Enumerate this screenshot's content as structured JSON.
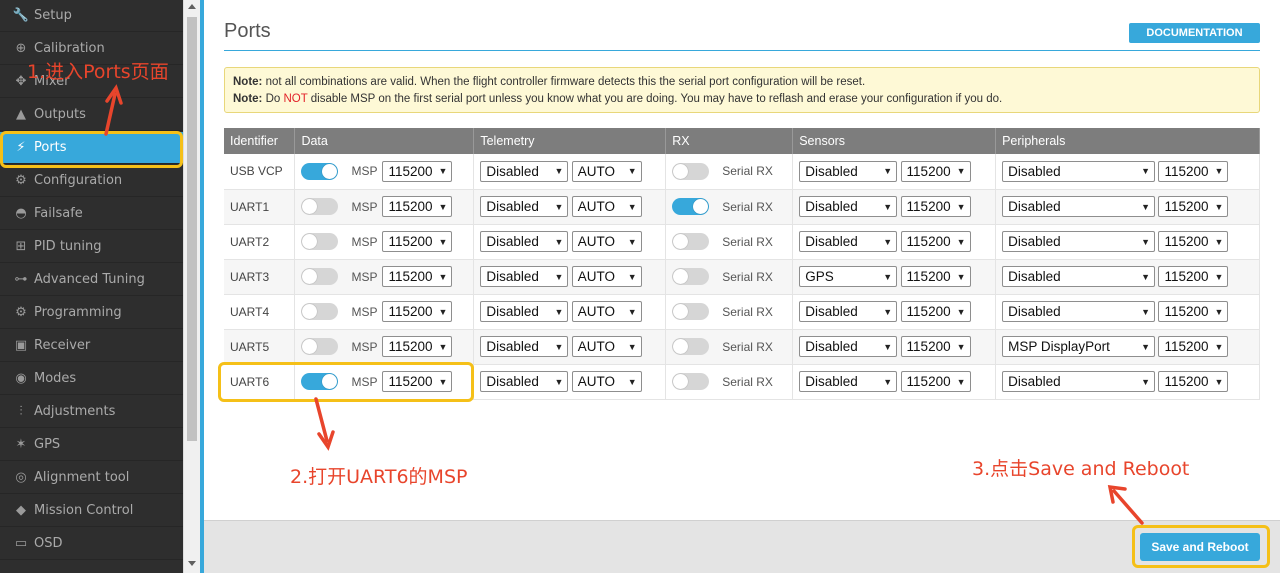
{
  "sidebar": {
    "items": [
      {
        "label": "Setup",
        "icon": "wrench-icon"
      },
      {
        "label": "Calibration",
        "icon": "crosshair-icon"
      },
      {
        "label": "Mixer",
        "icon": "mixer-icon"
      },
      {
        "label": "Outputs",
        "icon": "bolt-icon"
      },
      {
        "label": "Ports",
        "icon": "plug-icon"
      },
      {
        "label": "Configuration",
        "icon": "gear-icon"
      },
      {
        "label": "Failsafe",
        "icon": "parachute-icon"
      },
      {
        "label": "PID tuning",
        "icon": "pid-icon"
      },
      {
        "label": "Advanced Tuning",
        "icon": "tuning-icon"
      },
      {
        "label": "Programming",
        "icon": "gear-icon"
      },
      {
        "label": "Receiver",
        "icon": "receiver-icon"
      },
      {
        "label": "Modes",
        "icon": "modes-icon"
      },
      {
        "label": "Adjustments",
        "icon": "sliders-icon"
      },
      {
        "label": "GPS",
        "icon": "satellite-icon"
      },
      {
        "label": "Alignment tool",
        "icon": "compass-icon"
      },
      {
        "label": "Mission Control",
        "icon": "map-pin-icon"
      },
      {
        "label": "OSD",
        "icon": "osd-icon"
      }
    ],
    "active": "Ports"
  },
  "header": {
    "title": "Ports",
    "doc_button": "DOCUMENTATION"
  },
  "note": {
    "line1_label": "Note:",
    "line1_text": "not all combinations are valid. When the flight controller firmware detects this the serial port configuration will be reset.",
    "line2_label": "Note:",
    "line2_pre": "Do",
    "line2_not": "NOT",
    "line2_post": "disable MSP on the first serial port unless you know what you are doing. You may have to reflash and erase your configuration if you do."
  },
  "table": {
    "headers": [
      "Identifier",
      "Data",
      "Telemetry",
      "RX",
      "Sensors",
      "Peripherals"
    ],
    "msp_label": "MSP",
    "rx_label": "Serial RX",
    "rows": [
      {
        "id": "USB VCP",
        "msp_on": true,
        "msp_baud": "115200",
        "telemetry": "Disabled",
        "telemetry_baud": "AUTO",
        "rx_on": false,
        "sensors": "Disabled",
        "sensors_baud": "115200",
        "peripherals": "Disabled",
        "peripherals_baud": "115200"
      },
      {
        "id": "UART1",
        "msp_on": false,
        "msp_baud": "115200",
        "telemetry": "Disabled",
        "telemetry_baud": "AUTO",
        "rx_on": true,
        "sensors": "Disabled",
        "sensors_baud": "115200",
        "peripherals": "Disabled",
        "peripherals_baud": "115200"
      },
      {
        "id": "UART2",
        "msp_on": false,
        "msp_baud": "115200",
        "telemetry": "Disabled",
        "telemetry_baud": "AUTO",
        "rx_on": false,
        "sensors": "Disabled",
        "sensors_baud": "115200",
        "peripherals": "Disabled",
        "peripherals_baud": "115200"
      },
      {
        "id": "UART3",
        "msp_on": false,
        "msp_baud": "115200",
        "telemetry": "Disabled",
        "telemetry_baud": "AUTO",
        "rx_on": false,
        "sensors": "GPS",
        "sensors_baud": "115200",
        "peripherals": "Disabled",
        "peripherals_baud": "115200"
      },
      {
        "id": "UART4",
        "msp_on": false,
        "msp_baud": "115200",
        "telemetry": "Disabled",
        "telemetry_baud": "AUTO",
        "rx_on": false,
        "sensors": "Disabled",
        "sensors_baud": "115200",
        "peripherals": "Disabled",
        "peripherals_baud": "115200"
      },
      {
        "id": "UART5",
        "msp_on": false,
        "msp_baud": "115200",
        "telemetry": "Disabled",
        "telemetry_baud": "AUTO",
        "rx_on": false,
        "sensors": "Disabled",
        "sensors_baud": "115200",
        "peripherals": "MSP DisplayPort",
        "peripherals_baud": "115200"
      },
      {
        "id": "UART6",
        "msp_on": true,
        "msp_baud": "115200",
        "telemetry": "Disabled",
        "telemetry_baud": "AUTO",
        "rx_on": false,
        "sensors": "Disabled",
        "sensors_baud": "115200",
        "peripherals": "Disabled",
        "peripherals_baud": "115200"
      }
    ]
  },
  "footer": {
    "save_button": "Save and Reboot"
  },
  "annotations": {
    "step1": "1.进入Ports页面",
    "step2": "2.打开UART6的MSP",
    "step3": "3.点击Save and Reboot"
  },
  "colors": {
    "accent": "#37a8db",
    "sidebar_bg": "#2e2e2e",
    "highlight": "#f5c018",
    "annotation": "#e8452c"
  }
}
